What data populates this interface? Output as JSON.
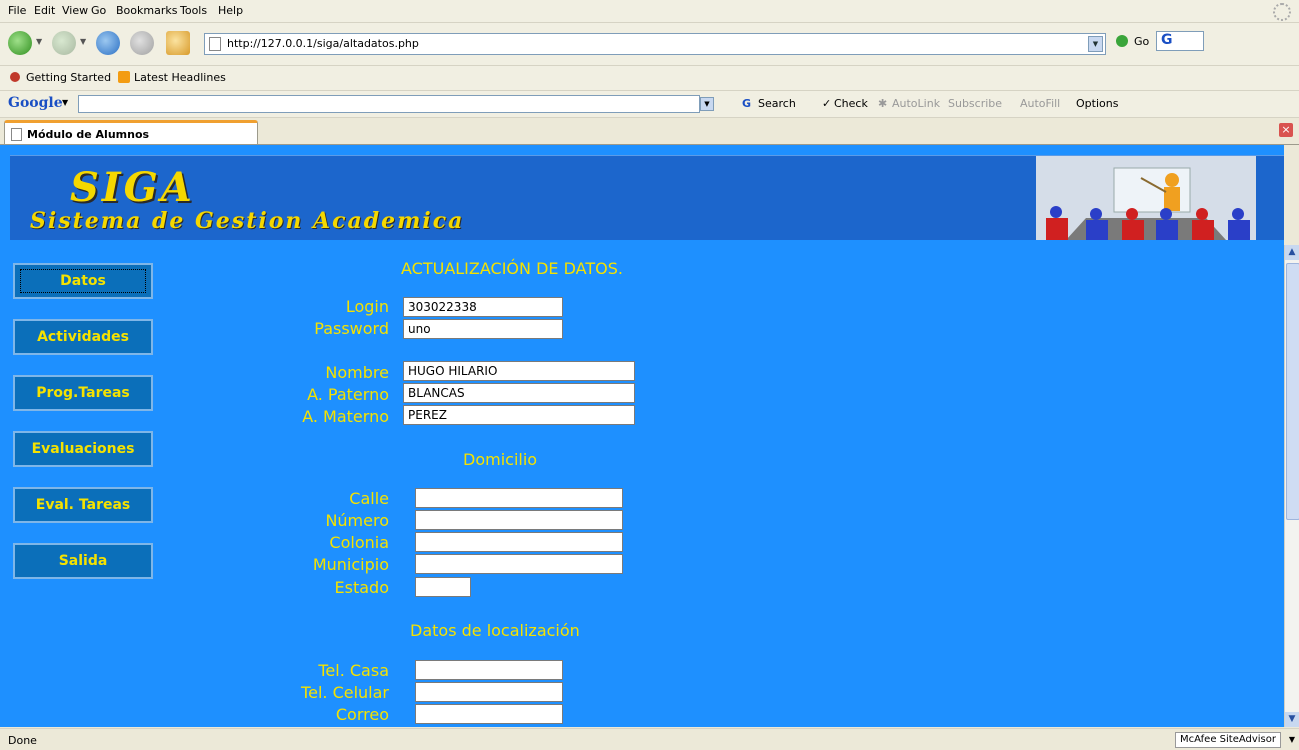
{
  "menu": [
    "File",
    "Edit",
    "View",
    "Go",
    "Bookmarks",
    "Tools",
    "Help"
  ],
  "nav": {
    "url": "http://127.0.0.1/siga/altadatos.php",
    "go_label": "Go"
  },
  "bookmarks": [
    "Getting Started",
    "Latest Headlines"
  ],
  "google_toolbar": {
    "logo": "Google",
    "items": [
      "Search",
      "Check",
      "AutoLink",
      "Subscribe",
      "AutoFill",
      "Options"
    ]
  },
  "tab": {
    "title": "Módulo de Alumnos"
  },
  "banner": {
    "logo": "SIGA",
    "subtitle": "Sistema de Gestion Academica"
  },
  "sidebar": [
    {
      "label": "Datos"
    },
    {
      "label": "Actividades"
    },
    {
      "label": "Prog.Tareas"
    },
    {
      "label": "Evaluaciones"
    },
    {
      "label": "Eval. Tareas"
    },
    {
      "label": "Salida"
    }
  ],
  "form": {
    "title": "ACTUALIZACIÓN DE DATOS.",
    "login_label": "Login",
    "login_value": "303022338",
    "password_label": "Password",
    "password_value": "uno",
    "nombre_label": "Nombre",
    "nombre_value": "HUGO HILARIO",
    "paterno_label": "A. Paterno",
    "paterno_value": "BLANCAS",
    "materno_label": "A. Materno",
    "materno_value": "PEREZ",
    "domicilio_title": "Domicilio",
    "calle_label": "Calle",
    "calle_value": "",
    "numero_label": "Número",
    "numero_value": "",
    "colonia_label": "Colonia",
    "colonia_value": "",
    "municipio_label": "Municipio",
    "municipio_value": "",
    "estado_label": "Estado",
    "estado_value": "",
    "localizacion_title": "Datos de localización",
    "telcasa_label": "Tel. Casa",
    "telcasa_value": "",
    "telcel_label": "Tel. Celular",
    "telcel_value": "",
    "correo_label": "Correo",
    "correo_value": ""
  },
  "status": {
    "text": "Done",
    "mcafee": "McAfee SiteAdvisor"
  }
}
